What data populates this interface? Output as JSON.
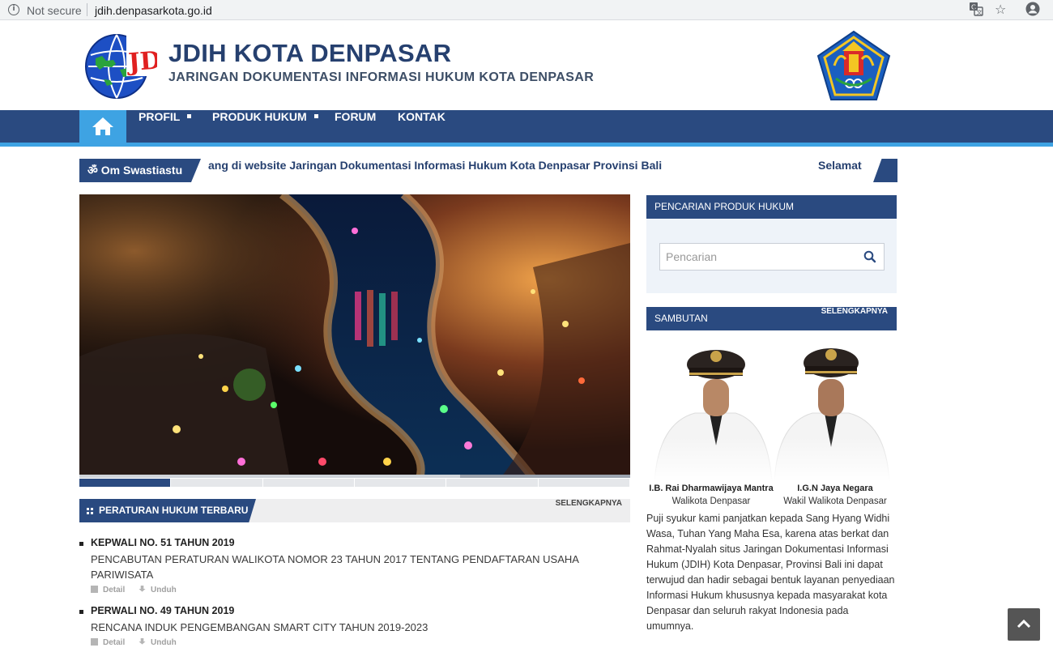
{
  "browser": {
    "security_label": "Not secure",
    "url": "jdih.denpasarkota.go.id"
  },
  "header": {
    "title": "JDIH KOTA DENPASAR",
    "subtitle": "JARINGAN DOKUMENTASI INFORMASI HUKUM KOTA DENPASAR"
  },
  "nav": {
    "items": [
      {
        "label": "PROFIL",
        "has_dropdown": true
      },
      {
        "label": "PRODUK HUKUM",
        "has_dropdown": true
      },
      {
        "label": "FORUM",
        "has_dropdown": false
      },
      {
        "label": "KONTAK",
        "has_dropdown": false
      }
    ]
  },
  "ticker": {
    "label": "Om Swastiastu",
    "text": "ang di website Jaringan Dokumentasi Informasi Hukum Kota Denpasar Provinsi Bali",
    "text_end": "Selamat"
  },
  "slider": {
    "slides_count": 6,
    "active_index": 0
  },
  "laws": {
    "section_title": "PERATURAN HUKUM TERBARU",
    "more_label": "SELENGKAPNYA",
    "items": [
      {
        "title": "KEPWALI NO. 51 TAHUN 2019",
        "desc": "PENCABUTAN PERATURAN WALIKOTA NOMOR 23 TAHUN 2017 TENTANG PENDAFTARAN USAHA PARIWISATA",
        "detail_label": "Detail",
        "download_label": "Unduh"
      },
      {
        "title": "PERWALI NO. 49 TAHUN 2019",
        "desc": "RENCANA INDUK PENGEMBANGAN SMART CITY TAHUN 2019-2023",
        "detail_label": "Detail",
        "download_label": "Unduh"
      }
    ]
  },
  "search": {
    "title": "PENCARIAN PRODUK HUKUM",
    "placeholder": "Pencarian"
  },
  "sambutan": {
    "title": "SAMBUTAN",
    "more_label": "SELENGKAPNYA",
    "officials": [
      {
        "name": "I.B. Rai Dharmawijaya Mantra",
        "role": "Walikota Denpasar"
      },
      {
        "name": "I.G.N Jaya Negara",
        "role": "Wakil Walikota Denpasar"
      }
    ],
    "text": "Puji syukur kami panjatkan kepada Sang Hyang Widhi Wasa, Tuhan Yang Maha Esa, karena atas berkat dan Rahmat-Nyalah situs Jaringan Dokumentasi Informasi Hukum (JDIH) Kota Denpasar,  Provinsi Bali ini dapat terwujud dan hadir sebagai bentuk layanan penyediaan Informasi Hukum khususnya kepada masyarakat kota Denpasar dan seluruh rakyat Indonesia pada umumnya."
  },
  "colors": {
    "primary": "#2a4a80",
    "accent": "#3ea3e3",
    "title": "#26406f"
  }
}
